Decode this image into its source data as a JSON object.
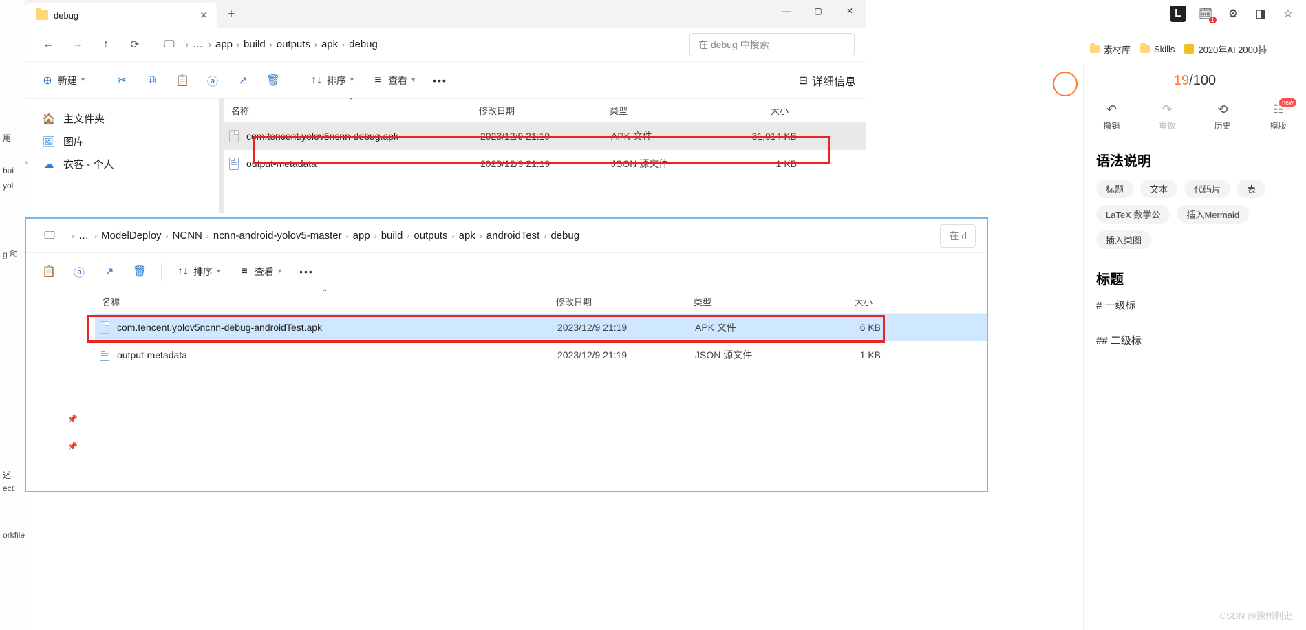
{
  "left_strip": [
    "用",
    "bui",
    "yol",
    "述",
    "ect",
    "g 和",
    "orkfile"
  ],
  "win1": {
    "tab_title": "debug",
    "breadcrumb": [
      "app",
      "build",
      "outputs",
      "apk",
      "debug"
    ],
    "search_placeholder": "在 debug 中搜索",
    "new_btn": "新建",
    "sort": "排序",
    "view": "查看",
    "details": "详细信息",
    "sidebar": {
      "home": "主文件夹",
      "gallery": "图库",
      "onedrive": "衣客 - 个人"
    },
    "columns": {
      "name": "名称",
      "date": "修改日期",
      "type": "类型",
      "size": "大小"
    },
    "files": [
      {
        "name": "com.tencent.yolov5ncnn-debug.apk",
        "date": "2023/12/9 21:19",
        "type": "APK 文件",
        "size": "31,014 KB",
        "selected": true,
        "icon": "file"
      },
      {
        "name": "output-metadata",
        "date": "2023/12/9 21:19",
        "type": "JSON 源文件",
        "size": "1 KB",
        "selected": false,
        "icon": "json"
      }
    ]
  },
  "win2": {
    "breadcrumb": [
      "ModelDeploy",
      "NCNN",
      "ncnn-android-yolov5-master",
      "app",
      "build",
      "outputs",
      "apk",
      "androidTest",
      "debug"
    ],
    "search_placeholder": "在 d",
    "sort": "排序",
    "view": "查看",
    "columns": {
      "name": "名称",
      "date": "修改日期",
      "type": "类型",
      "size": "大小"
    },
    "files": [
      {
        "name": "com.tencent.yolov5ncnn-debug-androidTest.apk",
        "date": "2023/12/9 21:19",
        "type": "APK 文件",
        "size": "6 KB",
        "selected": true,
        "icon": "file"
      },
      {
        "name": "output-metadata",
        "date": "2023/12/9 21:19",
        "type": "JSON 源文件",
        "size": "1 KB",
        "selected": false,
        "icon": "json"
      }
    ]
  },
  "bookmarks": [
    {
      "label": "素材库",
      "kind": "folder"
    },
    {
      "label": "Skills",
      "kind": "folder"
    },
    {
      "label": "2020年AI 2000排",
      "kind": "page"
    }
  ],
  "rpanel": {
    "count": "19",
    "total": "/100",
    "actions": {
      "undo": "撤销",
      "redo": "重做",
      "history": "历史",
      "template": "模版",
      "new": "new"
    },
    "syntax_title": "语法说明",
    "tags": [
      "标题",
      "文本",
      "代码片",
      "表",
      "LaTeX 数学公",
      "插入Mermaid",
      "插入类图"
    ],
    "heading": "标题",
    "h1": "#  一级标",
    "h2": "##  二级标"
  },
  "watermark": "CSDN @豫州刺史"
}
